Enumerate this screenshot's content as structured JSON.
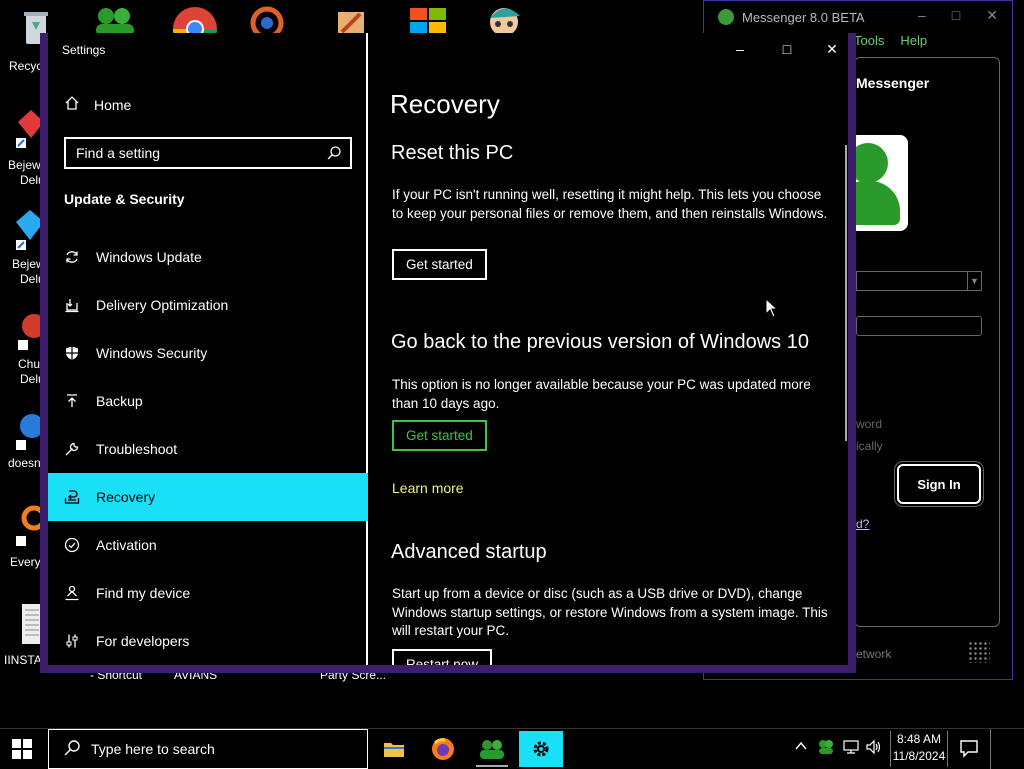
{
  "desktop": {
    "edge_labels": [
      "Recyc",
      "Bejew",
      "Delu",
      "Bejew",
      "Delu",
      "Chu",
      "Delu",
      "doesn",
      "Every",
      "IINSTA"
    ],
    "bottom_labels": [
      "- Shortcut",
      "AVIANS",
      "Party Scre..."
    ]
  },
  "messenger": {
    "title": "Messenger 8.0 BETA",
    "menu": [
      "Tools",
      "Help"
    ],
    "header": "Messenger",
    "faint1": "word",
    "faint2": "ically",
    "sign_in": "Sign In",
    "question_link": "d?",
    "network": "etwork"
  },
  "settings": {
    "app_title": "Settings",
    "home": "Home",
    "search_placeholder": "Find a setting",
    "section": "Update & Security",
    "nav": [
      {
        "label": "Windows Update",
        "icon": "refresh-icon"
      },
      {
        "label": "Delivery Optimization",
        "icon": "delivery-icon"
      },
      {
        "label": "Windows Security",
        "icon": "shield-icon"
      },
      {
        "label": "Backup",
        "icon": "backup-arrow-icon"
      },
      {
        "label": "Troubleshoot",
        "icon": "wrench-icon"
      },
      {
        "label": "Recovery",
        "icon": "recovery-icon",
        "active": true
      },
      {
        "label": "Activation",
        "icon": "check-circle-icon"
      },
      {
        "label": "Find my device",
        "icon": "person-pin-icon"
      },
      {
        "label": "For developers",
        "icon": "sliders-icon"
      }
    ],
    "page_title": "Recovery",
    "reset": {
      "heading": "Reset this PC",
      "text": "If your PC isn't running well, resetting it might help. This lets you choose to keep your personal files or remove them, and then reinstalls Windows.",
      "button": "Get started"
    },
    "goback": {
      "heading": "Go back to the previous version of Windows 10",
      "text": "This option is no longer available because your PC was updated more than 10 days ago.",
      "button": "Get started"
    },
    "learn_more": "Learn more",
    "advanced": {
      "heading": "Advanced startup",
      "text": "Start up from a device or disc (such as a USB drive or DVD), change Windows startup settings, or restore Windows from a system image. This will restart your PC.",
      "button": "Restart now"
    }
  },
  "taskbar": {
    "search_placeholder": "Type here to search",
    "time": "8:48 AM",
    "date": "11/8/2024"
  },
  "colors": {
    "accent": "#1ae0f7",
    "link": "#f5f57a",
    "green_border": "#3ec43e",
    "window_border": "#3b1f6a"
  }
}
